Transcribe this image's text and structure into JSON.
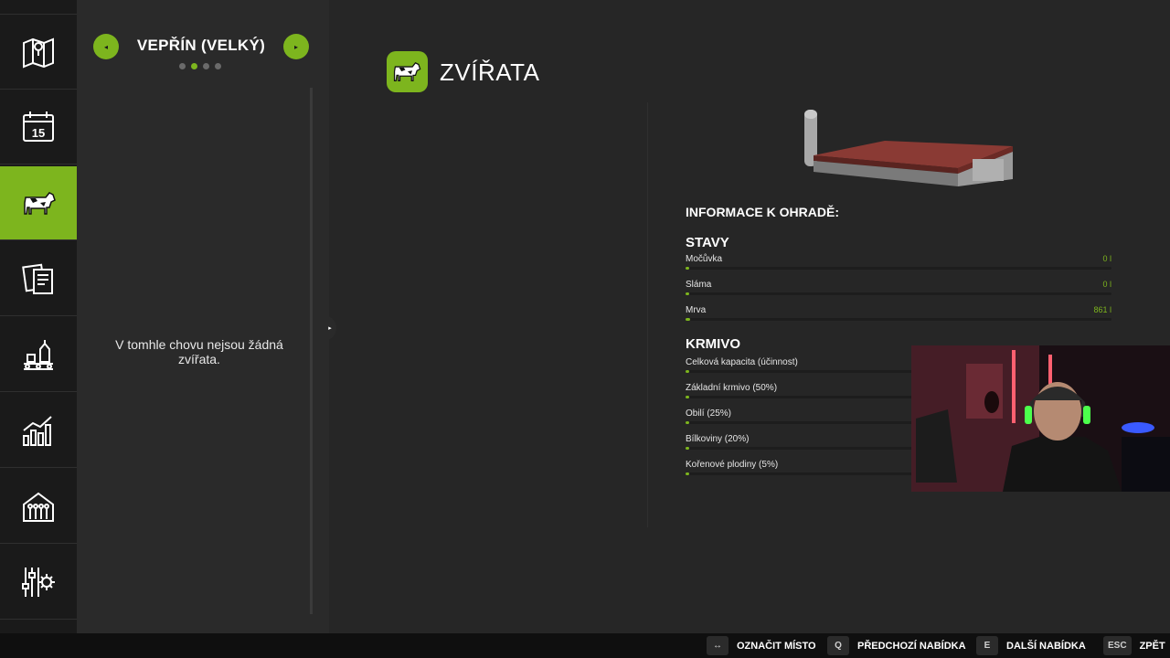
{
  "nav": {
    "items": [
      {
        "icon": "map-icon"
      },
      {
        "icon": "calendar-icon",
        "calendar_day": "15"
      },
      {
        "icon": "cow-icon",
        "active": true
      },
      {
        "icon": "contracts-icon"
      },
      {
        "icon": "production-icon"
      },
      {
        "icon": "statistics-icon"
      },
      {
        "icon": "barn-icon"
      },
      {
        "icon": "settings-icon"
      }
    ]
  },
  "side": {
    "prev_glyph": "◂",
    "next_glyph": "▸",
    "title": "VEPŘÍN (VELKÝ)",
    "page_count": 4,
    "active_page": 2,
    "empty_message": "V tomhle chovu nejsou žádná zvířata.",
    "collapse_glyph": "▸"
  },
  "main": {
    "title": "ZVÍŘATA",
    "info_heading": "INFORMACE K OHRADĚ:",
    "stavy": {
      "heading": "STAVY",
      "rows": [
        {
          "label": "Močůvka",
          "value": "0 l",
          "level": 0.0
        },
        {
          "label": "Sláma",
          "value": "0 l",
          "level": 0.0
        },
        {
          "label": "Mrva",
          "value": "861 l",
          "level": 0.01
        }
      ]
    },
    "krmivo": {
      "heading": "KRMIVO",
      "rows": [
        {
          "label": "Celková kapacita (účinnost)",
          "level": 0.0
        },
        {
          "label": "Základní krmivo (50%)",
          "level": 0.0
        },
        {
          "label": "Obilí (25%)",
          "level": 0.0
        },
        {
          "label": "Bílkoviny (20%)",
          "level": 0.0
        },
        {
          "label": "Kořenové plodiny (5%)",
          "level": 0.0
        }
      ]
    }
  },
  "footer": {
    "hints": [
      {
        "key": "↔",
        "label": "OZNAČIT MÍSTO"
      },
      {
        "key": "Q",
        "label": "PŘEDCHOZÍ NABÍDKA"
      },
      {
        "key": "E",
        "label": "DALŠÍ NABÍDKA"
      },
      {
        "key": "ESC",
        "label": "ZPĚT"
      }
    ]
  },
  "colors": {
    "accent": "#7db51e",
    "background": "#262626",
    "panel": "#2a2a2a",
    "nav": "#1a1a1a"
  }
}
